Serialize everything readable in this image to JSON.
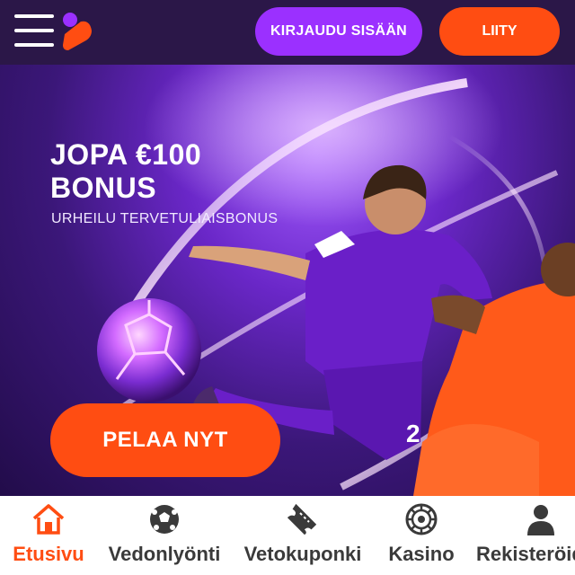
{
  "header": {
    "menu_icon": "hamburger-menu-icon",
    "logo": "brand-logo",
    "login_label": "KIRJAUDU SISÄÄN",
    "join_label": "LIITY"
  },
  "hero": {
    "title_line1": "JOPA €100",
    "title_line2": "BONUS",
    "subtitle": "URHEILU TERVETULIAISBONUS",
    "cta_label": "PELAA NYT",
    "jersey_number": "2"
  },
  "bottom_nav": [
    {
      "label": "Etusivu",
      "icon": "home-icon",
      "active": true
    },
    {
      "label": "Vedonlyönti",
      "icon": "soccer-ball-icon",
      "active": false
    },
    {
      "label": "Vetokuponki",
      "icon": "ticket-icon",
      "active": false
    },
    {
      "label": "Kasino",
      "icon": "roulette-icon",
      "active": false
    },
    {
      "label": "Rekisteröidy",
      "icon": "user-icon",
      "active": false
    }
  ],
  "colors": {
    "accent": "#ff4d12",
    "login_button": "#9b30ff",
    "header_bg": "#2b1748",
    "hero_purple": "#6a27c8"
  }
}
